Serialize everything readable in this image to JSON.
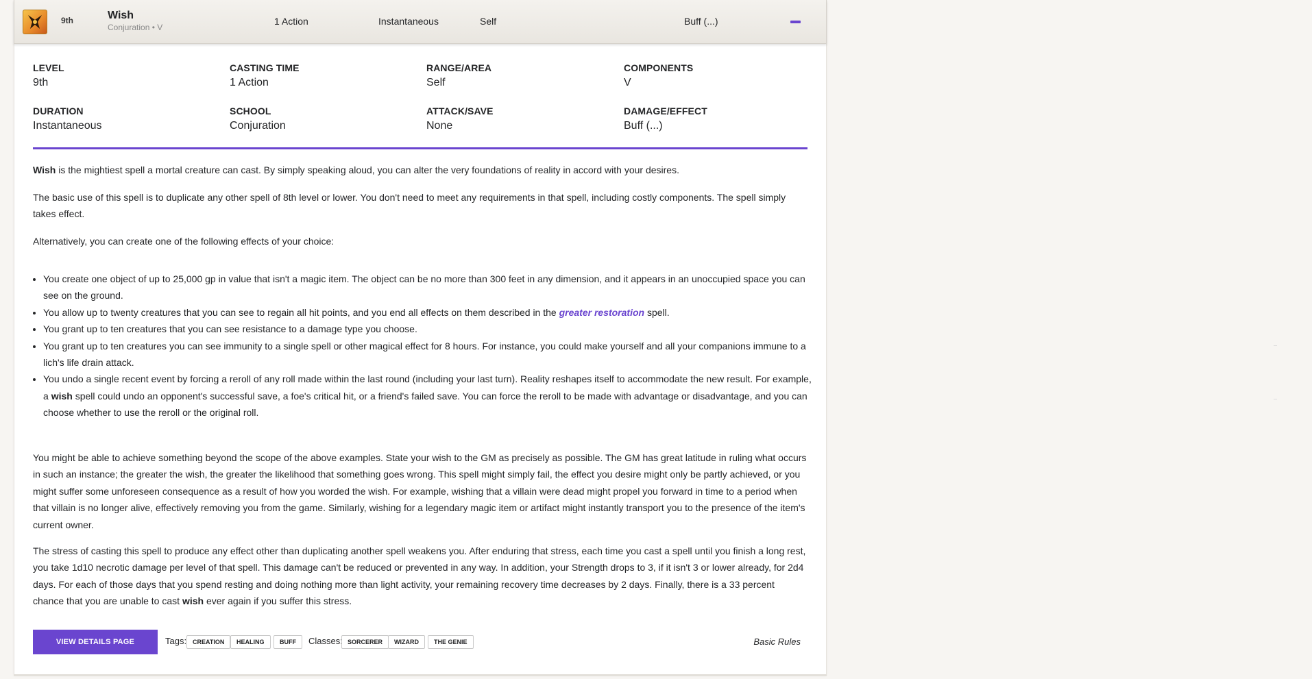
{
  "header": {
    "level": "9th",
    "name": "Wish",
    "subtitle": "Conjuration • V",
    "casting_time": "1 Action",
    "duration": "Instantaneous",
    "range": "Self",
    "effect": "Buff (...)"
  },
  "stats": {
    "level_label": "Level",
    "level_value": "9th",
    "casting_label": "Casting Time",
    "casting_value": "1 Action",
    "range_label": "Range/Area",
    "range_value": "Self",
    "components_label": "Components",
    "components_value": "V",
    "duration_label": "Duration",
    "duration_value": "Instantaneous",
    "school_label": "School",
    "school_value": "Conjuration",
    "attack_label": "Attack/Save",
    "attack_value": "None",
    "damage_label": "Damage/Effect",
    "damage_value": "Buff (...)"
  },
  "description": {
    "p1_bold": "Wish",
    "p1_rest": " is the mightiest spell a mortal creature can cast. By simply speaking aloud, you can alter the very foundations of reality in accord with your desires.",
    "p2": "The basic use of this spell is to duplicate any other spell of 8th level or lower. You don't need to meet any requirements in that spell, including costly components. The spell simply takes effect.",
    "p3": "Alternatively, you can create one of the following effects of your choice:",
    "bullet1": "You create one object of up to 25,000 gp in value that isn't a magic item. The object can be no more than 300 feet in any dimension, and it appears in an unoccupied space you can see on the ground.",
    "bullet2_a": "You allow up to twenty creatures that you can see to regain all hit points, and you end all effects on them described in the ",
    "bullet2_link": "greater restoration",
    "bullet2_b": " spell.",
    "bullet3": "You grant up to ten creatures that you can see resistance to a damage type you choose.",
    "bullet4": "You grant up to ten creatures you can see immunity to a single spell or other magical effect for 8 hours. For instance, you could make yourself and all your companions immune to a lich's life drain attack.",
    "bullet5_a": "You undo a single recent event by forcing a reroll of any roll made within the last round (including your last turn). Reality reshapes itself to accommodate the new result. For example, a ",
    "bullet5_bold": "wish",
    "bullet5_b": " spell could undo an opponent's successful save, a foe's critical hit, or a friend's failed save. You can force the reroll to be made with advantage or disadvantage, and you can choose whether to use the reroll or the original roll.",
    "p4": "You might be able to achieve something beyond the scope of the above examples. State your wish to the GM as precisely as possible. The GM has great latitude in ruling what occurs in such an instance; the greater the wish, the greater the likelihood that something goes wrong. This spell might simply fail, the effect you desire might only be partly achieved, or you might suffer some unforeseen consequence as a result of how you worded the wish. For example, wishing that a villain were dead might propel you forward in time to a period when that villain is no longer alive, effectively removing you from the game. Similarly, wishing for a legendary magic item or artifact might instantly transport you to the presence of the item's current owner.",
    "p5_a": "The stress of casting this spell to produce any effect other than duplicating another spell weakens you. After enduring that stress, each time you cast a spell until you finish a long rest, you take 1d10 necrotic damage per level of that spell. This damage can't be reduced or prevented in any way. In addition, your Strength drops to 3, if it isn't 3 or lower already, for 2d4 days. For each of those days that you spend resting and doing nothing more than light activity, your remaining recovery time decreases by 2 days. Finally, there is a 33 percent chance that you are unable to cast ",
    "p5_bold": "wish",
    "p5_b": " ever again if you suffer this stress."
  },
  "footer": {
    "details_button": "View Details Page",
    "tags_label": "Tags:",
    "tags": [
      "Creation",
      "Healing",
      "Buff"
    ],
    "classes_label": "Classes:",
    "classes": [
      "Sorcerer",
      "Wizard",
      "The Genie"
    ],
    "source": "Basic Rules"
  },
  "colors": {
    "accent": "#6a45cf",
    "text": "#242527",
    "icon_gradient_start": "#f6c34a",
    "icon_gradient_end": "#c8591c"
  }
}
